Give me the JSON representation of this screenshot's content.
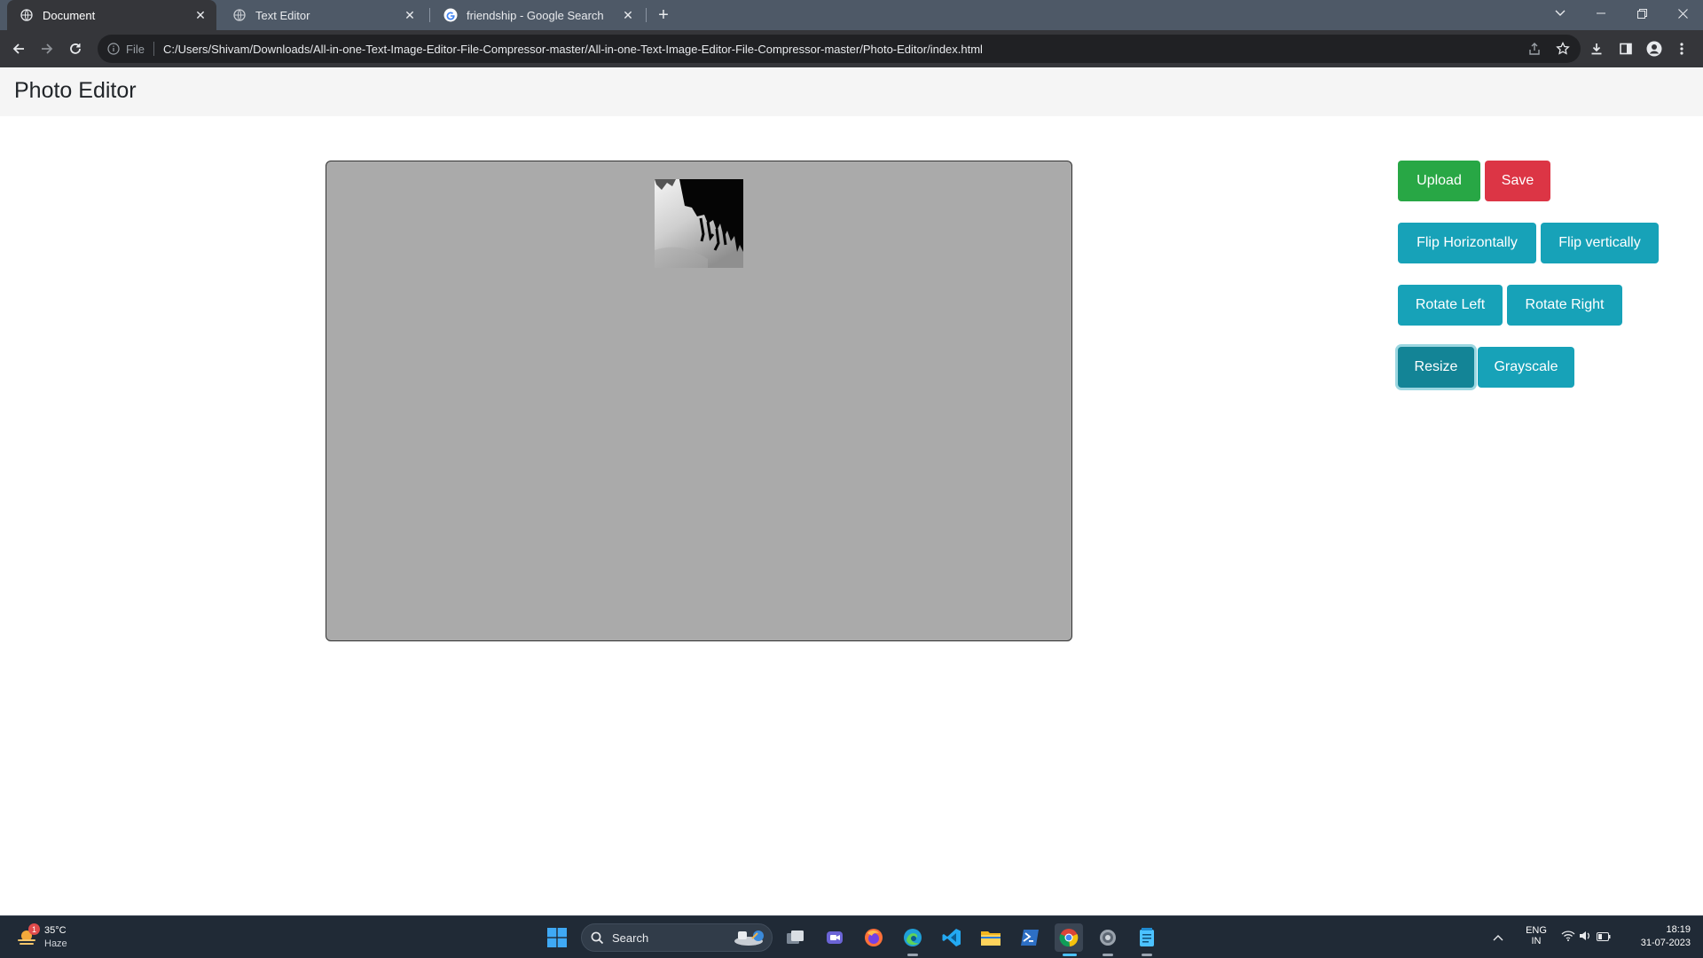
{
  "browser": {
    "tabs": [
      {
        "title": "Document",
        "active": true
      },
      {
        "title": "Text Editor",
        "active": false
      },
      {
        "title": "friendship - Google Search",
        "active": false
      }
    ],
    "omnibox": {
      "scheme_label": "File",
      "url": "C:/Users/Shivam/Downloads/All-in-one-Text-Image-Editor-File-Compressor-master/All-in-one-Text-Image-Editor-File-Compressor-master/Photo-Editor/index.html"
    }
  },
  "page": {
    "title": "Photo Editor",
    "buttons": {
      "upload": "Upload",
      "save": "Save",
      "flip_horizontal": "Flip Horizontally",
      "flip_vertical": "Flip vertically",
      "rotate_left": "Rotate Left",
      "rotate_right": "Rotate Right",
      "resize": "Resize",
      "grayscale": "Grayscale"
    }
  },
  "taskbar": {
    "weather": {
      "temp": "35°C",
      "condition": "Haze",
      "badge": "1"
    },
    "search_label": "Search",
    "language": {
      "line1": "ENG",
      "line2": "IN"
    },
    "clock": {
      "time": "18:19",
      "date": "31-07-2023"
    }
  },
  "colors": {
    "success": "#28a745",
    "danger": "#dc3545",
    "info": "#17a2b8",
    "canvas_bg": "#aaaaaa"
  }
}
